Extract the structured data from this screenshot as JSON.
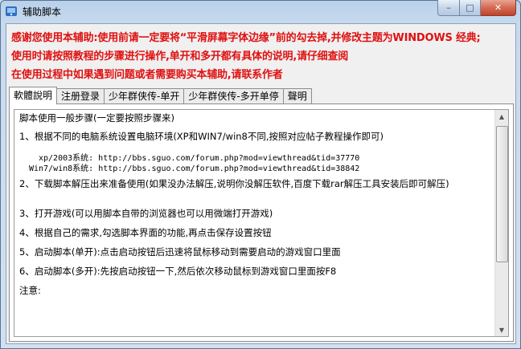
{
  "window": {
    "title": "辅助脚本",
    "controls": {
      "minimize": "–",
      "maximize": "□",
      "close": "✕"
    }
  },
  "notices": [
    "感谢您使用本辅助:使用前请一定要将“平滑屏幕字体边缘”前的勾去掉,并修改主题为WINDOWS 经典;",
    "使用时请按照教程的步骤进行操作,单开和多开都有具体的说明,请仔细查阅",
    "在使用过程中如果遇到问题或者需要购买本辅助,请联系作者"
  ],
  "tabs": [
    {
      "label": "軟體說明",
      "active": true
    },
    {
      "label": "注册登录",
      "active": false
    },
    {
      "label": "少年群侠传-单开",
      "active": false
    },
    {
      "label": "少年群侠传-多开单停",
      "active": false
    },
    {
      "label": "聲明",
      "active": false
    }
  ],
  "content": {
    "lines": [
      "脚本使用一般步骤(一定要按照步骤来)",
      "1、根据不同的电脑系统设置电脑环境(XP和WIN7/win8不同,按照对应帖子教程操作即可)",
      "xp/2003系统: http://bbs.sguo.com/forum.php?mod=viewthread&tid=37770",
      "Win7/win8系统: http://bbs.sguo.com/forum.php?mod=viewthread&tid=38842",
      "2、下载脚本解压出来准备使用(如果没办法解压,说明你没解压软件,百度下载rar解压工具安装后即可解压)",
      "3、打开游戏(可以用脚本自带的浏览器也可以用微端打开游戏)",
      "4、根据自己的需求,勾选脚本界面的功能,再点击保存设置按钮",
      "5、启动脚本(单开):点击启动按钮后迅速将鼠标移动到需要启动的游戏窗口里面",
      "6、启动脚本(多开):先按启动按钮一下,然后依次移动鼠标到游戏窗口里面按F8",
      "注意:"
    ]
  },
  "colors": {
    "notice_text": "#e01010",
    "frame": "#c9dbee"
  }
}
